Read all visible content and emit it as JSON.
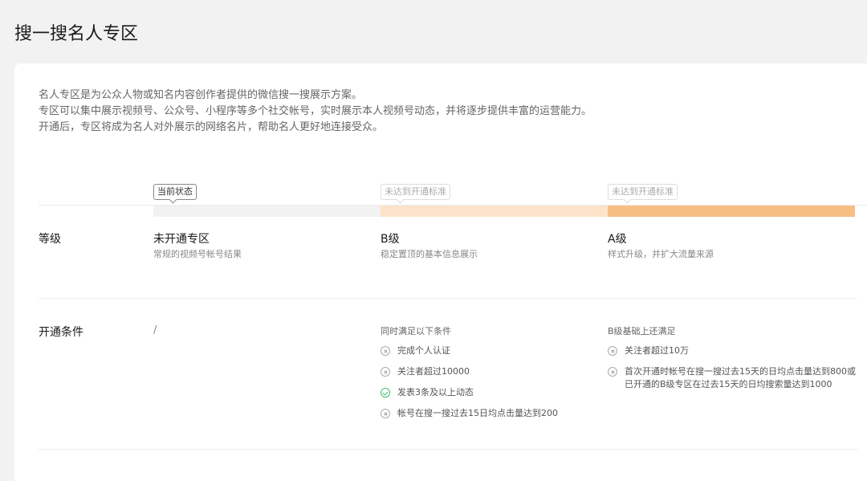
{
  "page": {
    "title": "搜一搜名人专区"
  },
  "intro": [
    "名人专区是为公众人物或知名内容创作者提供的微信搜一搜展示方案。",
    "专区可以集中展示视频号、公众号、小程序等多个社交帐号，实时展示本人视频号动态，并将逐步提供丰富的运营能力。",
    "开通后，专区将成为名人对外展示的网络名片，帮助名人更好地连接受众。"
  ],
  "progress": {
    "tags": [
      "当前状态",
      "未达到开通标准",
      "未达到开通标准"
    ],
    "colors": [
      "#f2f2f2",
      "#fde3c9",
      "#f7be83"
    ]
  },
  "rows": {
    "level_label": "等级",
    "conditions_label": "开通条件"
  },
  "levels": [
    {
      "name": "未开通专区",
      "desc": "常规的视频号帐号结果"
    },
    {
      "name": "B级",
      "desc": "稳定置顶的基本信息展示"
    },
    {
      "name": "A级",
      "desc": "样式升级，并扩大流量来源"
    }
  ],
  "conditions": {
    "none": "/",
    "b": {
      "heading": "同时满足以下条件",
      "items": [
        {
          "text": [
            "完成个人认证"
          ],
          "status": "fail",
          "icon": "x-circle-icon"
        },
        {
          "text": [
            "关注者超过10000"
          ],
          "status": "fail",
          "icon": "x-circle-icon"
        },
        {
          "text": [
            "发表3条及以上动态"
          ],
          "status": "pass",
          "icon": "check-circle-icon"
        },
        {
          "text": [
            "帐号在搜一搜过去15日均点击量达到200"
          ],
          "status": "fail",
          "icon": "x-circle-icon"
        }
      ]
    },
    "a": {
      "heading": "B级基础上还满足",
      "items": [
        {
          "text": [
            "关注者超过10万"
          ],
          "status": "fail",
          "icon": "x-circle-icon"
        },
        {
          "text": [
            "首次开通时帐号在搜一搜过去15天的日均点击量达到800或",
            "已开通的B级专区在过去15天的日均搜索量达到1000"
          ],
          "status": "fail",
          "icon": "x-circle-icon"
        }
      ]
    }
  }
}
